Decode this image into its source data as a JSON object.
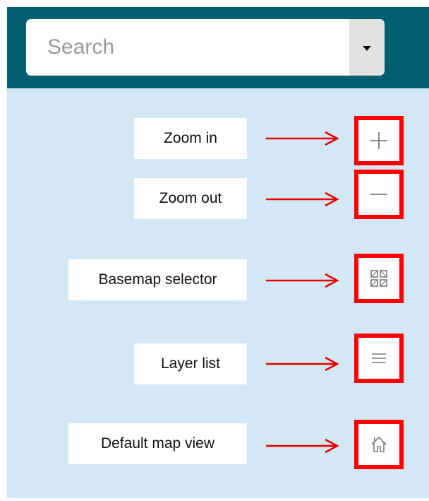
{
  "search": {
    "placeholder": "Search",
    "value": ""
  },
  "controls": [
    {
      "id": "zoom-in",
      "label": "Zoom in",
      "icon": "plus-icon"
    },
    {
      "id": "zoom-out",
      "label": "Zoom out",
      "icon": "minus-icon"
    },
    {
      "id": "basemap",
      "label": "Basemap selector",
      "icon": "basemap-grid-icon"
    },
    {
      "id": "layers",
      "label": "Layer list",
      "icon": "list-icon"
    },
    {
      "id": "home",
      "label": "Default map view",
      "icon": "home-icon"
    }
  ],
  "colors": {
    "header": "#005E6E",
    "map_background": "#D4E7F4",
    "highlight": "#FF0000",
    "arrow": "#E60000",
    "icon": "#7A7A7A"
  }
}
